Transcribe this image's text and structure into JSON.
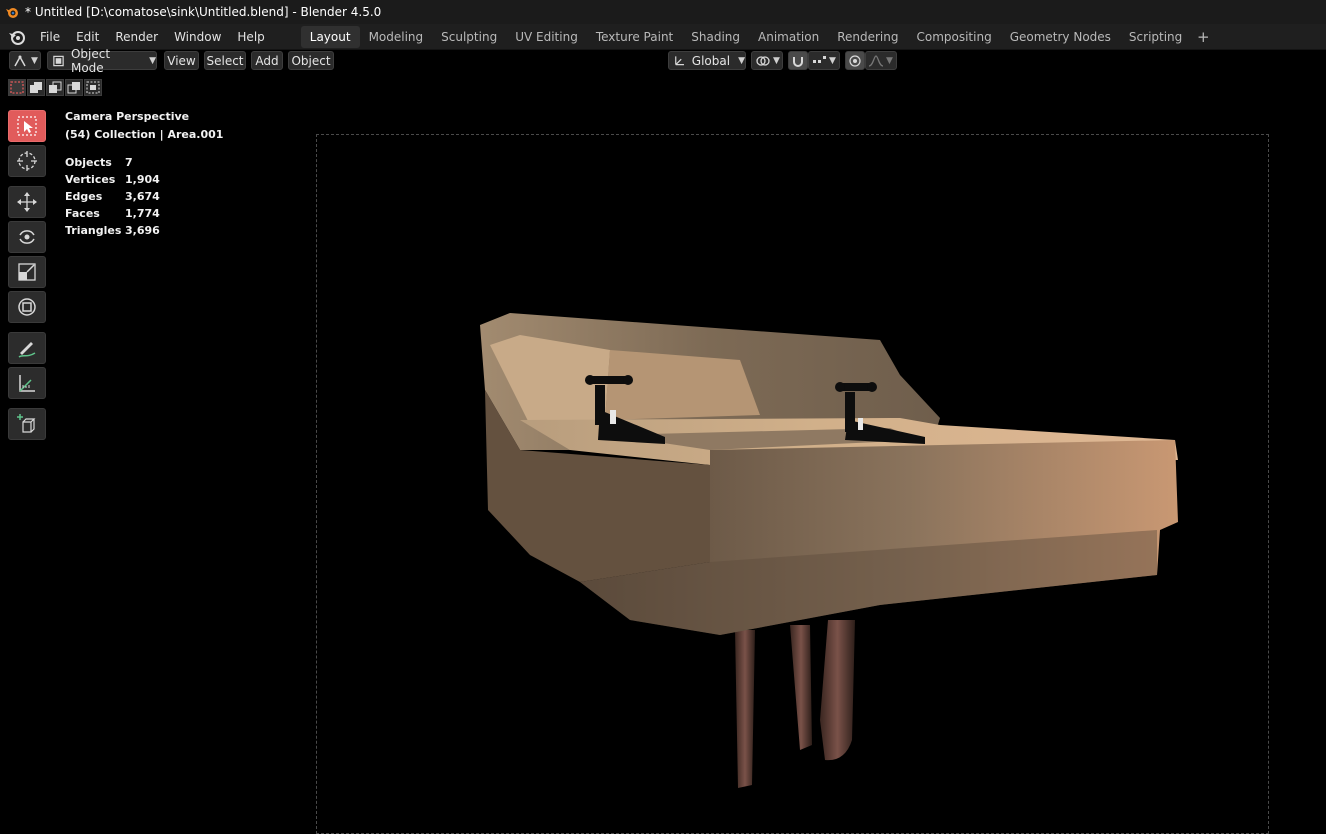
{
  "window": {
    "title": "* Untitled [D:\\comatose\\sink\\Untitled.blend] - Blender 4.5.0"
  },
  "menu": [
    {
      "label": "File"
    },
    {
      "label": "Edit"
    },
    {
      "label": "Render"
    },
    {
      "label": "Window"
    },
    {
      "label": "Help"
    }
  ],
  "workspaces": [
    {
      "label": "Layout",
      "active": true
    },
    {
      "label": "Modeling"
    },
    {
      "label": "Sculpting"
    },
    {
      "label": "UV Editing"
    },
    {
      "label": "Texture Paint"
    },
    {
      "label": "Shading"
    },
    {
      "label": "Animation"
    },
    {
      "label": "Rendering"
    },
    {
      "label": "Compositing"
    },
    {
      "label": "Geometry Nodes"
    },
    {
      "label": "Scripting"
    }
  ],
  "viewport_header": {
    "mode": "Object Mode",
    "view": "View",
    "select": "Select",
    "add": "Add",
    "object": "Object",
    "transform_orientation": "Global"
  },
  "overlay": {
    "view_name": "Camera Perspective",
    "collection": "(54) Collection | Area.001",
    "stats": [
      {
        "label": "Objects",
        "value": "7"
      },
      {
        "label": "Vertices",
        "value": "1,904"
      },
      {
        "label": "Edges",
        "value": "3,674"
      },
      {
        "label": "Faces",
        "value": "1,774"
      },
      {
        "label": "Triangles",
        "value": "3,696"
      }
    ]
  },
  "tools": [
    {
      "icon": "select-box-icon",
      "active": true
    },
    {
      "icon": "cursor-icon"
    },
    {
      "icon": "move-icon"
    },
    {
      "icon": "rotate-icon"
    },
    {
      "icon": "scale-icon"
    },
    {
      "icon": "transform-icon"
    },
    {
      "icon": "annotate-icon"
    },
    {
      "icon": "measure-icon"
    },
    {
      "icon": "add-cube-icon"
    }
  ],
  "colors": {
    "accent_active_tool": "#e15b5b",
    "viewport_background": "#000000",
    "sink": "#c9a982",
    "pipe": "#6d4c43"
  }
}
